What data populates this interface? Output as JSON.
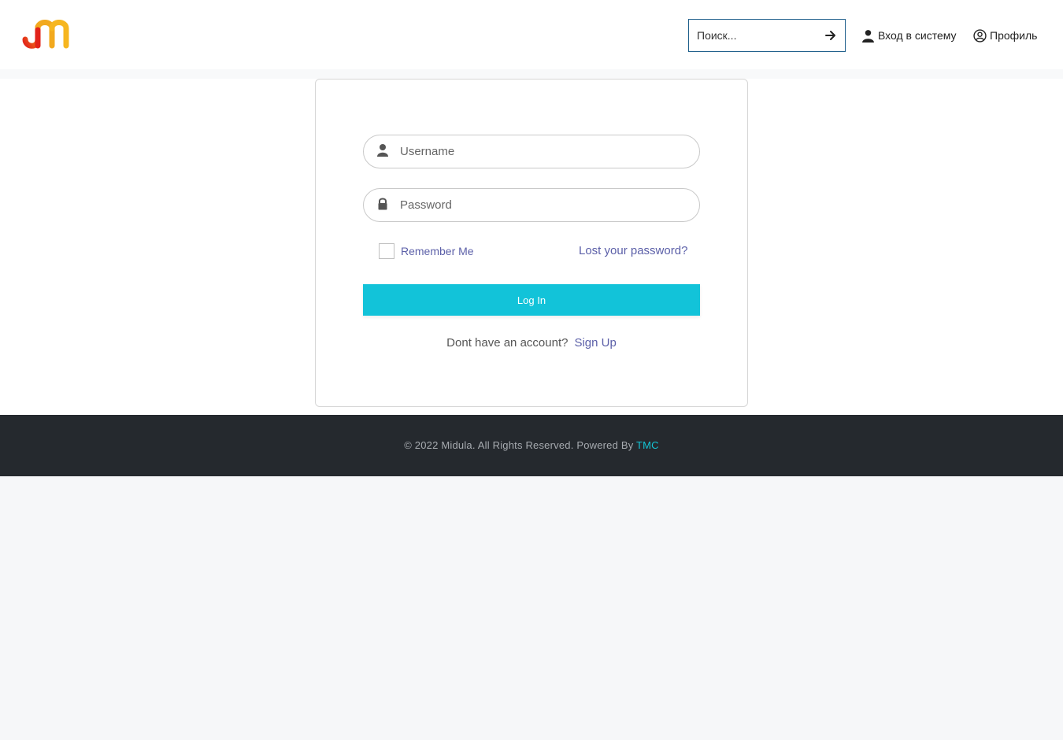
{
  "header": {
    "search": {
      "placeholder": "Поиск...",
      "value": ""
    },
    "nav": {
      "login_label": "Вход в систему",
      "profile_label": "Профиль"
    }
  },
  "login_form": {
    "username_placeholder": "Username",
    "password_placeholder": "Password",
    "remember_label": "Remember Me",
    "remember_checked": false,
    "lost_password_label": "Lost your password?",
    "submit_label": "Log In",
    "signup_prompt": "Dont have an account?",
    "signup_label": "Sign Up"
  },
  "footer": {
    "copyright": "© 2022 Midula. All Rights Reserved. Powered By",
    "powered_link": "TMC"
  },
  "icons": {
    "logo": "jm-logo",
    "search_submit": "arrow-right-icon",
    "login": "user-icon",
    "profile": "user-circle-icon",
    "username": "user-icon",
    "password": "lock-icon"
  },
  "colors": {
    "accent": "#12c3d9",
    "link": "#5b5fa8",
    "footer_bg": "#25292e",
    "footer_link": "#14c3d4",
    "search_border": "#1f5f8b"
  }
}
